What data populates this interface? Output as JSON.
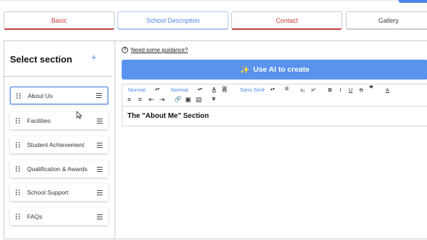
{
  "tabs": [
    {
      "label": "Basic"
    },
    {
      "label": "School Description"
    },
    {
      "label": "Contact"
    },
    {
      "label": "Gallery"
    }
  ],
  "sidebar": {
    "title": "Select section",
    "add_icon": "+",
    "items": [
      {
        "label": "About Us"
      },
      {
        "label": "Facilities"
      },
      {
        "label": "Student Achievement"
      },
      {
        "label": "Qualification & Awards"
      },
      {
        "label": "School Support"
      },
      {
        "label": "FAQs"
      }
    ]
  },
  "main": {
    "guidance_icon": "?",
    "guidance_label": "Need some guidance?",
    "ai_button": {
      "icon": "✨",
      "label": "Use AI to create"
    },
    "toolbar": {
      "heading_select": "Normal",
      "size_select": "Normal",
      "font_select": "Sans Serif",
      "glyphs": {
        "text_color": "A",
        "background": "A",
        "align": "≡",
        "subscript": "x₂",
        "superscript": "x²",
        "bold": "B",
        "italic": "I",
        "underline": "U",
        "strike": "S",
        "blockquote": "❞",
        "clear": "A",
        "ordered_list": "≡",
        "bullet_list": "≡",
        "outdent": "⇤",
        "indent": "⇥",
        "link": "🔗",
        "image": "▣",
        "video": "▤",
        "clean": "T"
      }
    },
    "editor_text": "The \"About Me\" Section"
  },
  "colors": {
    "accent": "#4a86e8",
    "error": "#c93a3a",
    "ai_button": "#5a93ee"
  }
}
